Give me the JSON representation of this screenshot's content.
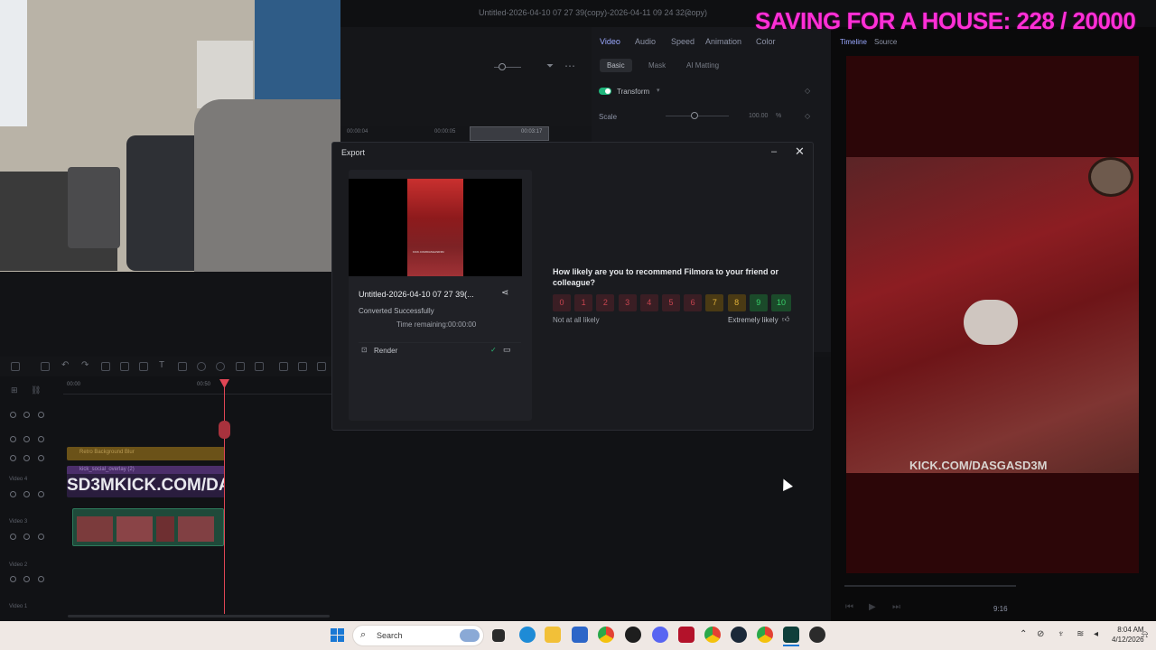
{
  "app": {
    "window_title": "Untitled-2026-04-10 07 27 39(copy)-2026-04-11 09 24 32(copy)"
  },
  "property_panel": {
    "tabs": [
      "Video",
      "Audio",
      "Speed",
      "Animation",
      "Color"
    ],
    "active_tab": "Video",
    "subtabs": [
      "Basic",
      "Mask",
      "AI Matting"
    ],
    "active_subtab": "Basic",
    "transform_label": "Transform",
    "scale_label": "Scale",
    "scale_value": "100.00",
    "scale_unit": "%",
    "scale_level": 0.45
  },
  "preview": {
    "tabs": [
      "Timeline",
      "Source"
    ],
    "watermark": "KICK.COM/DASGASD3M",
    "aspect": "9:16",
    "top_timecode_a": "00:00:04",
    "top_timecode_b": "00:00:05",
    "top_timecode_c": "00:03:17"
  },
  "timeline": {
    "ruler": [
      "00:00",
      "00:50"
    ],
    "tracks": [
      {
        "name": "",
        "clip": ""
      },
      {
        "name": "",
        "clip": ""
      },
      {
        "name": "",
        "clip": "Retro Background Blur"
      },
      {
        "name": "Video 4",
        "clip": "kick_social_overlay (2)"
      },
      {
        "name": "Video 3",
        "clip": ""
      },
      {
        "name": "Video 2",
        "clip": ""
      },
      {
        "name": "Video 1",
        "clip": ""
      }
    ],
    "overlay_clip_text": "SD3MKICK.COM/DA"
  },
  "overlay": {
    "stream_goal": "SAVING FOR A HOUSE: 228 / 20000"
  },
  "export_dialog": {
    "title": "Export",
    "file_name": "Untitled-2026-04-10 07 27 39(...",
    "status": "Converted Successfully",
    "time_remaining": "Time remaining:00:00:00",
    "render_label": "Render",
    "survey_question": "How likely are you to recommend Filmora to your friend or colleague?",
    "scores": [
      "0",
      "1",
      "2",
      "3",
      "4",
      "5",
      "6",
      "7",
      "8",
      "9",
      "10"
    ],
    "low_label": "Not at all likely",
    "high_label": "Extremely likely",
    "thumb_caption": "KICK.COM/DASGASD3M"
  },
  "taskbar": {
    "search_placeholder": "Search",
    "time": "8:04 AM",
    "date": "4/12/2026"
  },
  "colors": {
    "accent": "#9aa8ff",
    "toggle_on": "#1fb67c",
    "playhead": "#e04655",
    "overlay_text": "#ff2fd6",
    "score_low": "#c7444f",
    "score_mid": "#e0b13a",
    "score_high": "#38d06a"
  }
}
